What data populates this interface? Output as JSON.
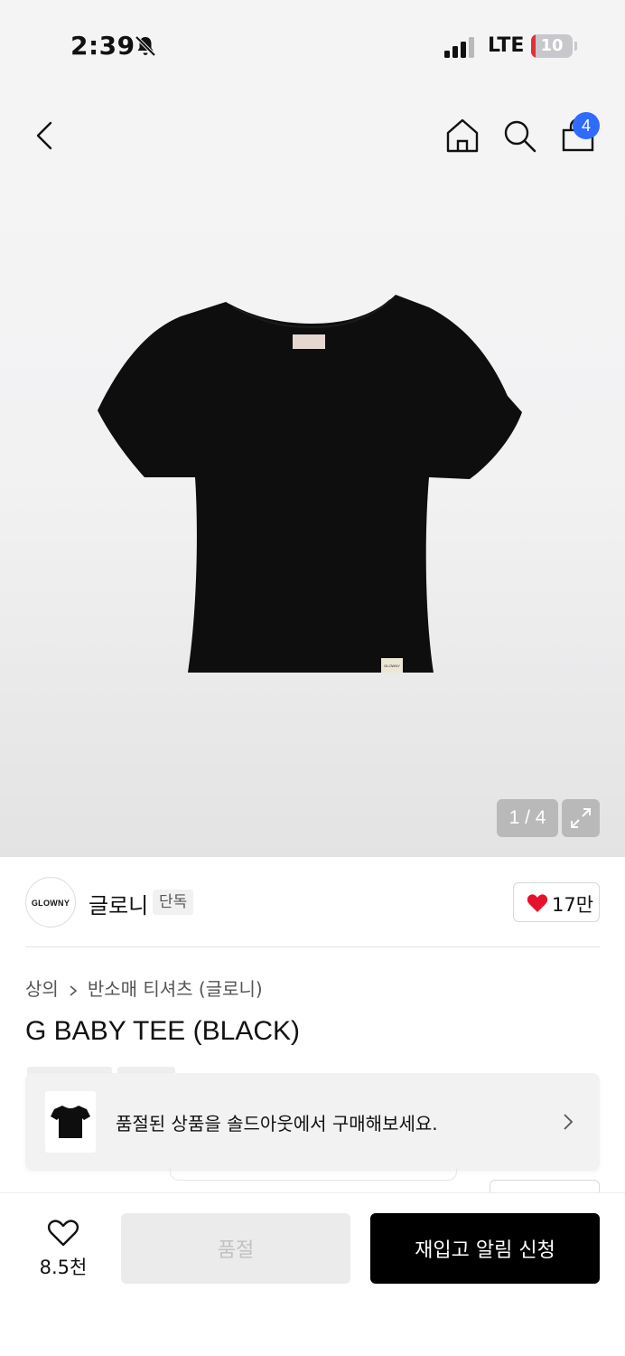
{
  "status_bar": {
    "time": "2:39",
    "network": "LTE",
    "battery": "10",
    "battery_level": 0.1,
    "battery_color": "#e0313a"
  },
  "header": {
    "cart_count": "4",
    "icons": [
      "back-icon",
      "home-icon",
      "search-icon",
      "shopping-bag-icon"
    ],
    "badge_color": "#2f6bff"
  },
  "gallery": {
    "counter": "1 / 4",
    "product_color": "#0e0e0e",
    "tag_text": "GLOWNY"
  },
  "brand": {
    "logo_text": "GLOWNY",
    "name": "글로니",
    "tag": "단독",
    "likes": "17만",
    "heart_color": "#e8112b"
  },
  "product": {
    "breadcrumb": [
      "상의",
      "반소매 티셔츠 (글로니)"
    ],
    "title": "G BABY TEE (BLACK)"
  },
  "soldout_banner": {
    "text": "품절된 상품을 솔드아웃에서 구매해보세요."
  },
  "bottom_bar": {
    "wish_count": "8.5천",
    "soldout_label": "품절",
    "restock_label": "재입고 알림 신청"
  }
}
